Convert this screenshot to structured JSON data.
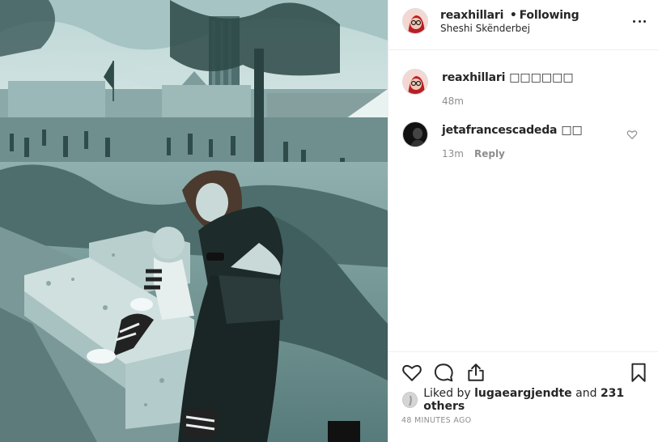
{
  "post": {
    "photo_alt": "",
    "header": {
      "username": "reaxhillari",
      "separator": "•",
      "follow_status": "Following",
      "location": "Sheshi Skënderbej"
    },
    "comments": [
      {
        "username": "reaxhillari",
        "text": "□□□□□□",
        "time": "48m",
        "reply_label": ""
      },
      {
        "username": "jetafrancescadeda",
        "text": "□□",
        "time": "13m",
        "reply_label": "Reply"
      }
    ],
    "likes": {
      "prefix": "Liked by",
      "first_liker": "lugaeargjendte",
      "connector": "and",
      "others": "231 others"
    },
    "timestamp": "48 MINUTES AGO",
    "icons": {
      "like": "heart-icon",
      "comment": "comment-icon",
      "share": "share-icon",
      "save": "bookmark-icon",
      "more": "more-options-icon"
    },
    "colors": {
      "photo_tint": "#6f9493",
      "text": "#262626",
      "muted": "#8e8e8e",
      "divider": "#efefef"
    }
  }
}
